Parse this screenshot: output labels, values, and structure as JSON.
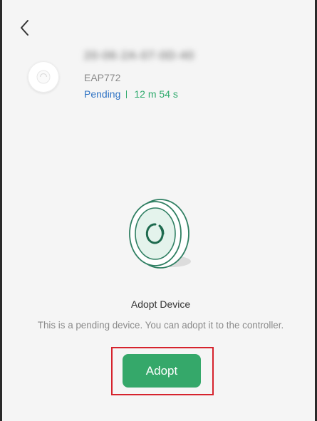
{
  "device": {
    "name": "20-06-2A-07-0D-40",
    "model": "EAP772",
    "status": "Pending",
    "time": "12 m 54 s"
  },
  "adopt": {
    "title": "Adopt Device",
    "description": "This is a pending device. You can adopt it to the controller.",
    "button_label": "Adopt"
  },
  "colors": {
    "accent_green": "#35a86a",
    "status_blue": "#2f73c4",
    "highlight_red": "#d6232d"
  },
  "icons": {
    "back": "chevron-left-icon",
    "device": "access-point-icon",
    "illustration": "access-point-illustration"
  }
}
